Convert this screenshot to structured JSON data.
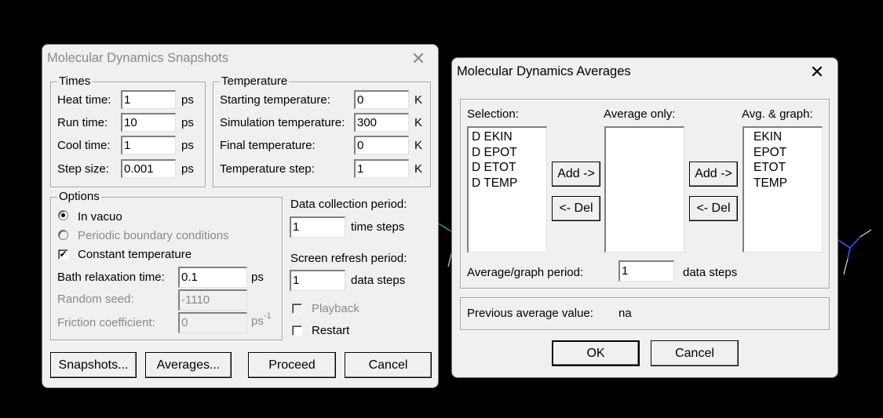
{
  "snapshots_dialog": {
    "title": "Molecular Dynamics Snapshots",
    "times": {
      "legend": "Times",
      "heat_time": {
        "label": "Heat time:",
        "value": "1",
        "unit": "ps"
      },
      "run_time": {
        "label": "Run time:",
        "value": "10",
        "unit": "ps"
      },
      "cool_time": {
        "label": "Cool time:",
        "value": "1",
        "unit": "ps"
      },
      "step_size": {
        "label": "Step size:",
        "value": "0.001",
        "unit": "ps"
      }
    },
    "temperature": {
      "legend": "Temperature",
      "starting": {
        "label": "Starting temperature:",
        "value": "0",
        "unit": "K"
      },
      "simulation": {
        "label": "Simulation temperature:",
        "value": "300",
        "unit": "K"
      },
      "final": {
        "label": "Final temperature:",
        "value": "0",
        "unit": "K"
      },
      "step": {
        "label": "Temperature step:",
        "value": "1",
        "unit": "K"
      }
    },
    "options": {
      "legend": "Options",
      "in_vacuo": "In vacuo",
      "periodic": "Periodic boundary conditions",
      "constant_temp": "Constant temperature",
      "bath": {
        "label": "Bath relaxation time:",
        "value": "0.1",
        "unit": "ps"
      },
      "seed": {
        "label": "Random seed:",
        "value": "-1110"
      },
      "friction": {
        "label": "Friction coefficient:",
        "value": "0",
        "unit": "ps",
        "unit_sup": "-1"
      }
    },
    "data_collection": {
      "label": "Data collection period:",
      "value": "1",
      "unit": "time steps"
    },
    "screen_refresh": {
      "label": "Screen refresh period:",
      "value": "1",
      "unit": "data steps"
    },
    "playback": "Playback",
    "restart": "Restart",
    "buttons": {
      "snapshots": "Snapshots...",
      "averages": "Averages...",
      "proceed": "Proceed",
      "cancel": "Cancel"
    }
  },
  "averages_dialog": {
    "title": "Molecular Dynamics Averages",
    "selection_label": "Selection:",
    "selection_items": [
      "D EKIN",
      "D EPOT",
      "D ETOT",
      "D TEMP"
    ],
    "average_only_label": "Average only:",
    "avg_graph_label": "Avg. & graph:",
    "avg_graph_items": [
      "EKIN",
      "EPOT",
      "ETOT",
      "TEMP"
    ],
    "add_label": "Add ->",
    "del_label": "<- Del",
    "period": {
      "label": "Average/graph period:",
      "value": "1",
      "unit": "data steps"
    },
    "previous": {
      "label": "Previous average value:",
      "value": "na"
    },
    "buttons": {
      "ok": "OK",
      "cancel": "Cancel"
    }
  }
}
